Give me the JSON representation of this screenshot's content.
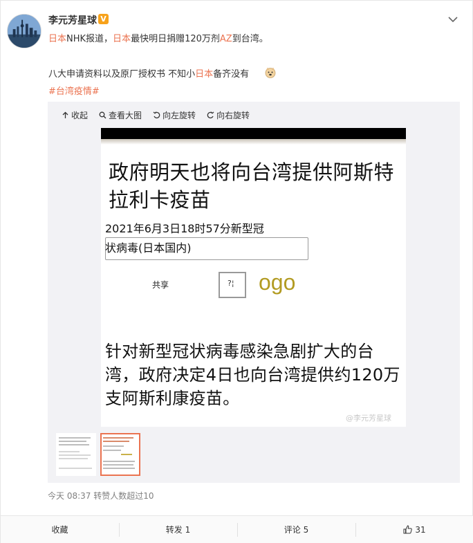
{
  "post": {
    "username": "李元芳星球",
    "verified_badge": "V",
    "line1": [
      {
        "text": "日本",
        "hl": true
      },
      {
        "text": "NHK报道，",
        "hl": false
      },
      {
        "text": "日本",
        "hl": true
      },
      {
        "text": "最快明日捐赠120万剂",
        "hl": false
      },
      {
        "text": "AZ",
        "hl": true
      },
      {
        "text": "到台湾。",
        "hl": false
      }
    ],
    "line2": [
      {
        "text": "八大申请资料以及原厂授权书 不知小",
        "hl": false
      },
      {
        "text": "日本",
        "hl": true
      },
      {
        "text": "备齐没有",
        "hl": false
      }
    ],
    "hashtag": "#台湾疫情#",
    "timestamp": "今天 08:37 转赞人数超过10"
  },
  "media": {
    "toolbar": {
      "collapse": "收起",
      "view_large": "查看大图",
      "rotate_left": "向左旋转",
      "rotate_right": "向右旋转"
    },
    "image": {
      "title": "政府明天也将向台湾提供阿斯特拉利卡疫苗",
      "date": "2021年6月3日18时57分新型冠",
      "box_text": "状病毒(日本国内)",
      "share": "共享",
      "qbox": "?¦",
      "ogo": "ogo",
      "body": "针对新型冠状病毒感染急剧扩大的台湾，政府决定4日也向台湾提供约120万支阿斯利康疫苗。",
      "watermark": "@李元芳星球"
    }
  },
  "footer": {
    "favorite": "收藏",
    "repost": "转发 1",
    "comment": "评论 5",
    "like": "31"
  },
  "colors": {
    "accent": "#eb7350",
    "ogo": "#b29b22"
  }
}
